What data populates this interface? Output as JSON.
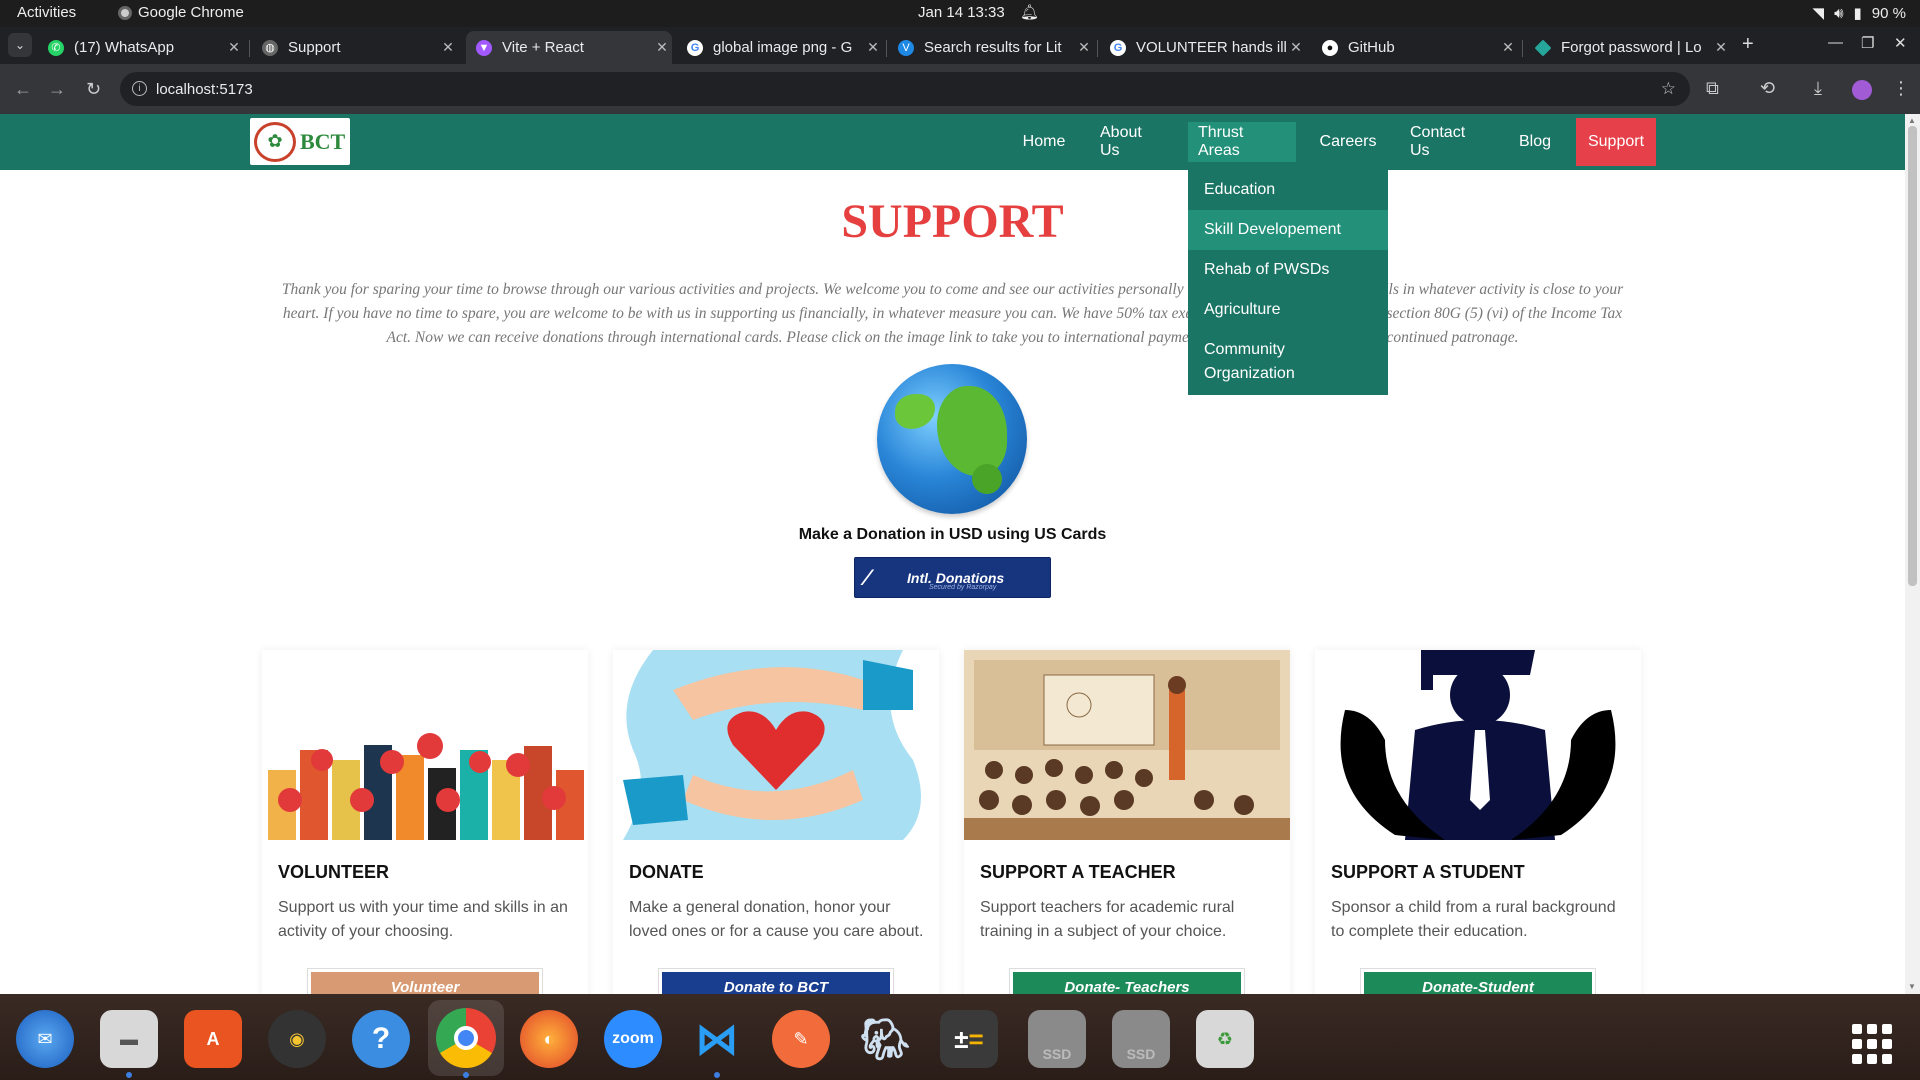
{
  "system": {
    "activities": "Activities",
    "app_name": "Google Chrome",
    "clock": "Jan 14  13:33",
    "battery": "90 %"
  },
  "tabs": [
    {
      "title": "(17) WhatsApp",
      "icon": "whatsapp-icon",
      "color": "#25d366"
    },
    {
      "title": "Support",
      "icon": "globe-icon",
      "color": "#888888"
    },
    {
      "title": "Vite + React",
      "icon": "vite-icon",
      "color": "#a259ff"
    },
    {
      "title": "global image png - G",
      "icon": "google-icon",
      "color": "#4285f4"
    },
    {
      "title": "Search results for Lit",
      "icon": "vuetify-icon",
      "color": "#1e88e5"
    },
    {
      "title": "VOLUNTEER hands ill",
      "icon": "google-icon",
      "color": "#4285f4"
    },
    {
      "title": "GitHub",
      "icon": "github-icon",
      "color": "#ffffff"
    },
    {
      "title": "Forgot password | Lo",
      "icon": "diamond-icon",
      "color": "#26a69a"
    }
  ],
  "address": {
    "url": "localhost:5173"
  },
  "nav": {
    "logo_text": "BCT",
    "items": [
      "Home",
      "About Us",
      "Thrust Areas",
      "Careers",
      "Contact Us",
      "Blog",
      "Support"
    ],
    "dropdown": [
      "Education",
      "Skill Developement",
      "Rehab of PWSDs",
      "Agriculture",
      "Community Organization"
    ],
    "highlighted_dropdown_index": 1,
    "brand_color": "#1b7565",
    "support_color": "#e6414a"
  },
  "support": {
    "title": "SUPPORT",
    "intro": "Thank you for sparing your time to browse through our various activities and projects. We welcome you to come and see our activities personally and volunteer your time and skills in whatever activity is close to your heart. If you have no time to spare, you are welcome to be with us in supporting us financially, in whatever measure you can. We have 50% tax exemption for all donations under section 80G (5) (vi) of the Income Tax Act. Now we can receive donations through international cards. Please click on the image link to take you to international payment gateway. Thank you for your continued patronage.",
    "donation_caption": "Make a Donation in USD using US Cards",
    "intl_button": {
      "label": "Intl. Donations",
      "sub": "Secured by Razorpay"
    }
  },
  "cards": [
    {
      "title": "VOLUNTEER",
      "desc": "Support us with your time and skills in an activity of your choosing.",
      "button": "Volunteer",
      "button_color": "#d89a72"
    },
    {
      "title": "DONATE",
      "desc": "Make a general donation, honor your loved ones or for a cause you care about.",
      "button": "Donate to BCT",
      "button_color": "#1a3e8f"
    },
    {
      "title": "SUPPORT A TEACHER",
      "desc": "Support teachers for academic rural training in a subject of your choice.",
      "button": "Donate- Teachers",
      "button_color": "#1d8a5a"
    },
    {
      "title": "SUPPORT A STUDENT",
      "desc": "Sponsor a child from a rural background to complete their education.",
      "button": "Donate-Student",
      "button_color": "#1d8a5a"
    }
  ],
  "dock": [
    "thunderbird-icon",
    "files-icon",
    "app-center-icon",
    "rhythmbox-icon",
    "help-icon",
    "chrome-icon",
    "firefox-icon",
    "zoom-icon",
    "vscode-icon",
    "postman-icon",
    "pgadmin-icon",
    "calculator-icon",
    "drive-icon",
    "drive-icon",
    "trash-icon",
    "app-grid-icon"
  ],
  "dock_labels": {
    "zoom": "zoom",
    "ssd": "SSD"
  }
}
